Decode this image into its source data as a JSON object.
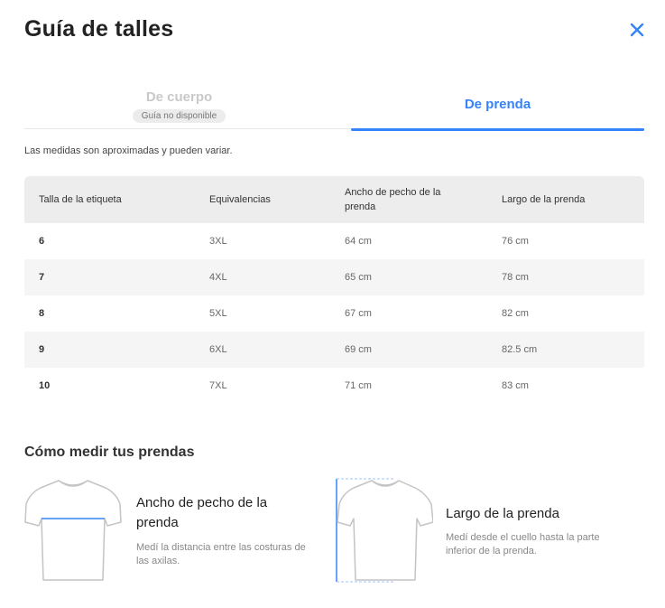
{
  "header": {
    "title": "Guía de talles",
    "close_icon": "close-icon"
  },
  "tabs": [
    {
      "label": "De cuerpo",
      "badge": "Guía no disponible",
      "state": "disabled"
    },
    {
      "label": "De prenda",
      "state": "active"
    }
  ],
  "note": "Las medidas son aproximadas y pueden variar.",
  "table": {
    "columns": [
      "Talla de la etiqueta",
      "Equivalencias",
      "Ancho de pecho de la prenda",
      "Largo de la prenda"
    ],
    "rows": [
      [
        "6",
        "3XL",
        "64 cm",
        "76 cm"
      ],
      [
        "7",
        "4XL",
        "65 cm",
        "78 cm"
      ],
      [
        "8",
        "5XL",
        "67 cm",
        "82 cm"
      ],
      [
        "9",
        "6XL",
        "69 cm",
        "82.5 cm"
      ],
      [
        "10",
        "7XL",
        "71 cm",
        "83 cm"
      ]
    ]
  },
  "how_to": {
    "title": "Cómo medir tus prendas",
    "items": [
      {
        "icon": "shirt-chest-icon",
        "heading": "Ancho de pecho de la prenda",
        "description": "Medí la distancia entre las costuras de las axilas."
      },
      {
        "icon": "shirt-length-icon",
        "heading": "Largo de la prenda",
        "description": "Medí desde el cuello hasta la parte inferior de la prenda."
      }
    ]
  },
  "colors": {
    "accent": "#3483fa",
    "header_bg": "#ededed",
    "alt_row_bg": "#f5f5f5"
  }
}
